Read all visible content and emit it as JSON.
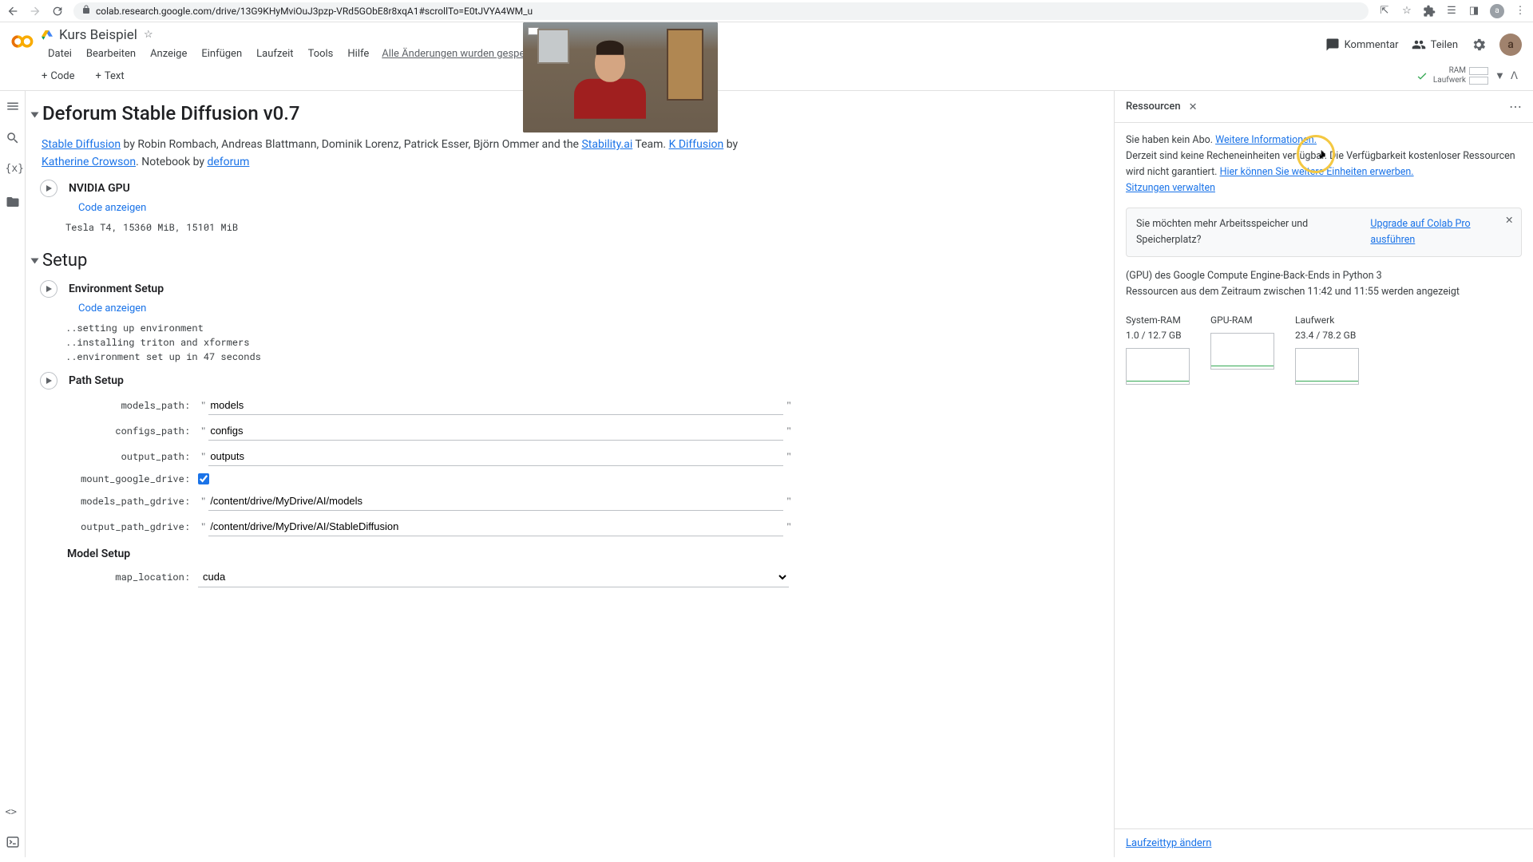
{
  "browser": {
    "url": "colab.research.google.com/drive/13G9KHyMviOuJ3pzp-VRd5GObE8r8xqA1#scrollTo=E0tJVYA4WM_u",
    "avatar": "a"
  },
  "header": {
    "title": "Kurs Beispiel",
    "menu": [
      "Datei",
      "Bearbeiten",
      "Anzeige",
      "Einfügen",
      "Laufzeit",
      "Tools",
      "Hilfe"
    ],
    "saved": "Alle Änderungen wurden gespeichert",
    "comment": "Kommentar",
    "share": "Teilen",
    "avatar": "a"
  },
  "toolbar": {
    "code": "Code",
    "text": "Text",
    "runtime": {
      "ram": "RAM",
      "disk": "Laufwerk"
    }
  },
  "doc": {
    "title": "Deforum Stable Diffusion v0.7",
    "intro": {
      "sd_link": "Stable Diffusion",
      "by1": " by Robin Rombach, Andreas Blattmann, Dominik Lorenz, Patrick Esser, Björn Ommer and the ",
      "stability": "Stability.ai",
      "team": " Team. ",
      "kdiff": "K Diffusion",
      "by2": " by ",
      "kath": "Katherine Crowson",
      "nb": ". Notebook by ",
      "deforum": "deforum"
    }
  },
  "cells": {
    "gpu": {
      "title": "NVIDIA GPU",
      "toggle": "Code anzeigen",
      "output": "Tesla T4, 15360 MiB, 15101 MiB"
    },
    "setup_title": "Setup",
    "env": {
      "title": "Environment Setup",
      "toggle": "Code anzeigen",
      "output": "..setting up environment\n..installing triton and xformers\n..environment set up in 47 seconds"
    },
    "path": {
      "title": "Path Setup",
      "fields": {
        "models_path": {
          "label": "models_path:",
          "value": "models"
        },
        "configs_path": {
          "label": "configs_path:",
          "value": "configs"
        },
        "output_path": {
          "label": "output_path:",
          "value": "outputs"
        },
        "mount_google_drive": {
          "label": "mount_google_drive:",
          "checked": true
        },
        "models_path_gdrive": {
          "label": "models_path_gdrive:",
          "value": "/content/drive/MyDrive/AI/models"
        },
        "output_path_gdrive": {
          "label": "output_path_gdrive:",
          "value": "/content/drive/MyDrive/AI/StableDiffusion"
        }
      }
    },
    "model": {
      "title": "Model Setup",
      "map_location": {
        "label": "map_location:",
        "value": "cuda"
      }
    }
  },
  "panel": {
    "title": "Ressourcen",
    "no_sub": "Sie haben kein Abo. ",
    "more_info": "Weitere Informationen.",
    "no_units": "Derzeit sind keine Recheneinheiten verfügbar. Die Verfügbarkeit kostenloser Ressourcen wird nicht garantiert. ",
    "buy_units": "Hier können Sie weitere Einheiten erwerben.",
    "manage_sessions": "Sitzungen verwalten",
    "upsell": {
      "q": "Sie möchten mehr Arbeitsspeicher und Speicherplatz?",
      "link": "Upgrade auf Colab Pro ausführen"
    },
    "backend": "(GPU) des Google Compute Engine-Back-Ends in Python 3",
    "timerange": "Ressourcen aus dem Zeitraum zwischen 11:42 und 11:55 werden angezeigt",
    "resources": {
      "system_ram": {
        "label": "System-RAM",
        "value": "1.0 / 12.7 GB"
      },
      "gpu_ram": {
        "label": "GPU-RAM",
        "value": ""
      },
      "disk": {
        "label": "Laufwerk",
        "value": "23.4 / 78.2 GB"
      }
    },
    "footer_link": "Laufzeittyp ändern"
  }
}
